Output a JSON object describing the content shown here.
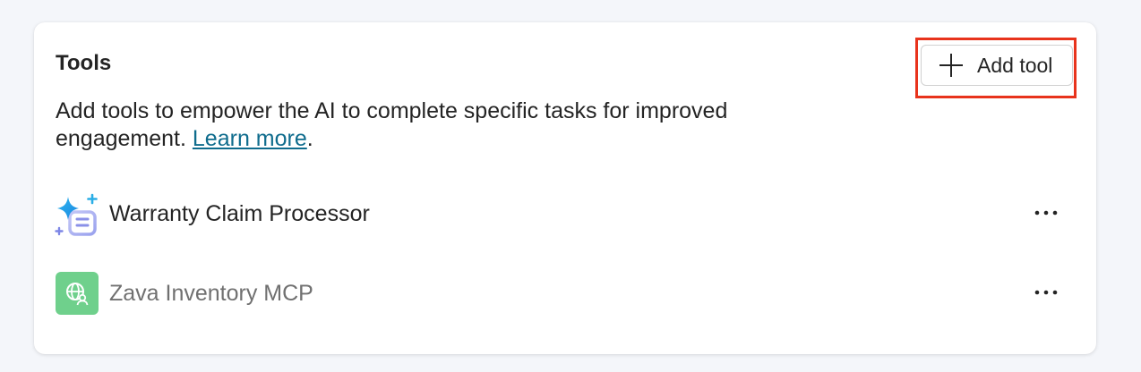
{
  "tools_card": {
    "title": "Tools",
    "add_button_label": "Add tool",
    "description": "Add tools to empower the AI to complete specific tasks for improved engagement. ",
    "learn_more_label": "Learn more",
    "description_suffix": ".",
    "items": [
      {
        "name": "Warranty Claim Processor",
        "icon": "sparkle-list-icon",
        "text_color": "#242424"
      },
      {
        "name": "Zava Inventory MCP",
        "icon": "globe-person-icon",
        "text_color": "#707070"
      }
    ]
  },
  "colors": {
    "highlight": "#e8331c",
    "link": "#0f6c8d",
    "mcp_icon_bg": "#6fd08c"
  }
}
